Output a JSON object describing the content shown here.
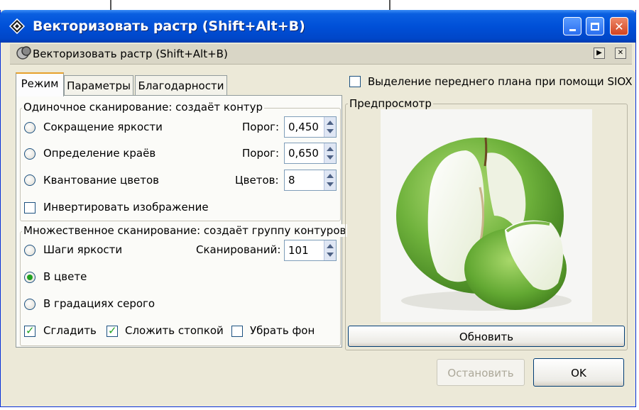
{
  "window": {
    "title": "Векторизовать растр (Shift+Alt+B)",
    "buttons": {
      "minimize": "minimize",
      "maximize": "maximize",
      "close": "close"
    }
  },
  "dock": {
    "title": "Векторизовать растр (Shift+Alt+B)"
  },
  "tabs": [
    "Режим",
    "Параметры",
    "Благодарности"
  ],
  "single_scan": {
    "legend": "Одиночное сканирование: создаёт контур",
    "options": [
      {
        "label": "Сокращение яркости",
        "param_label": "Порог:",
        "value": "0,450",
        "selected": false
      },
      {
        "label": "Определение краёв",
        "param_label": "Порог:",
        "value": "0,650",
        "selected": false
      },
      {
        "label": "Квантование цветов",
        "param_label": "Цветов:",
        "value": "8",
        "selected": false
      }
    ],
    "invert_label": "Инвертировать изображение",
    "invert_checked": false
  },
  "multi_scan": {
    "legend": "Множественное сканирование: создаёт группу контуров",
    "options": [
      {
        "label": "Шаги яркости",
        "selected": false
      },
      {
        "label": "В цвете",
        "selected": true
      },
      {
        "label": "В градациях серого",
        "selected": false
      }
    ],
    "scans_label": "Сканирований:",
    "scans_value": "101",
    "checks": [
      {
        "label": "Сгладить",
        "checked": true
      },
      {
        "label": "Сложить стопкой",
        "checked": true
      },
      {
        "label": "Убрать фон",
        "checked": false
      }
    ]
  },
  "siox": {
    "label": "Выделение переднего плана при помощи SIOX",
    "checked": false
  },
  "preview": {
    "legend": "Предпросмотр",
    "update_label": "Обновить"
  },
  "footer": {
    "stop_label": "Остановить",
    "ok_label": "OK"
  },
  "colors": {
    "titlebar": "#0050d8",
    "dialog_bg": "#ece9d8",
    "check_green": "#21a121",
    "apple_green": "#6fb23c"
  }
}
